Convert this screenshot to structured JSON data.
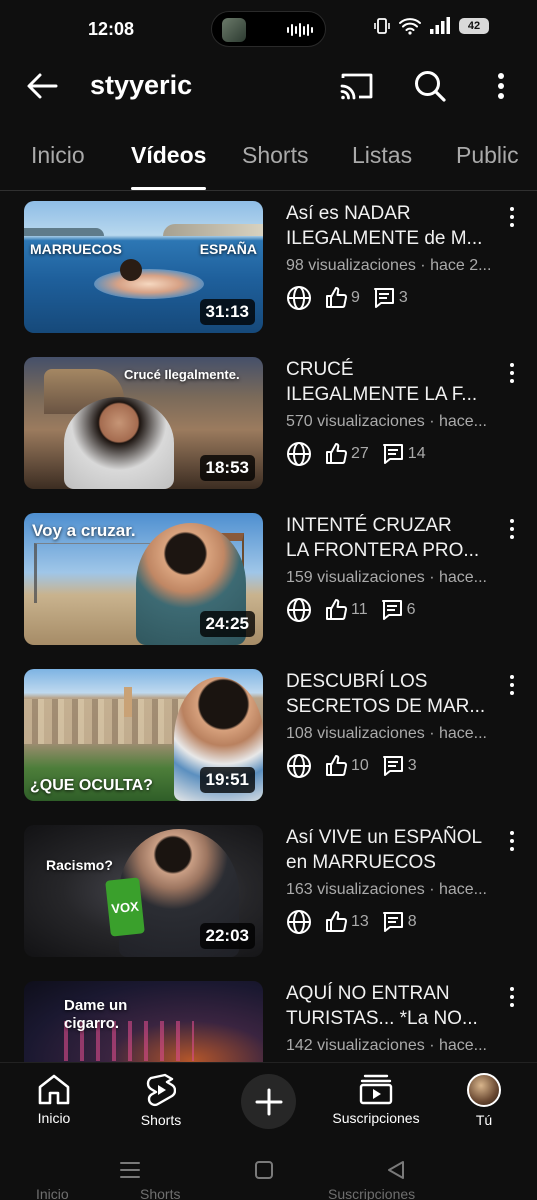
{
  "status": {
    "time": "12:08",
    "battery": "42"
  },
  "header": {
    "title": "styyeric"
  },
  "tabs": [
    "Inicio",
    "Vídeos",
    "Shorts",
    "Listas",
    "Public"
  ],
  "videos": [
    {
      "title_line1": "Así es NADAR",
      "title_line2": "ILEGALMENTE de M...",
      "meta": "98 visualizaciones · hace 2...",
      "likes": "9",
      "comments": "3",
      "duration": "31:13",
      "thumb_text": [
        "MARRUECOS",
        "ESPAÑA"
      ]
    },
    {
      "title_line1": "CRUCÉ",
      "title_line2": "ILEGALMENTE LA F...",
      "meta": "570 visualizaciones · hace...",
      "likes": "27",
      "comments": "14",
      "duration": "18:53",
      "thumb_text": [
        "Crucé Ilegalmente."
      ]
    },
    {
      "title_line1": "INTENTÉ CRUZAR",
      "title_line2": "LA FRONTERA PRO...",
      "meta": "159 visualizaciones · hace...",
      "likes": "11",
      "comments": "6",
      "duration": "24:25",
      "thumb_text": [
        "Voy a cruzar."
      ]
    },
    {
      "title_line1": "DESCUBRÍ LOS",
      "title_line2": "SECRETOS DE MAR...",
      "meta": "108 visualizaciones · hace...",
      "likes": "10",
      "comments": "3",
      "duration": "19:51",
      "thumb_text": [
        "¿QUE OCULTA?"
      ]
    },
    {
      "title_line1": "Así VIVE un ESPAÑOL",
      "title_line2": "en MARRUECOS",
      "meta": "163 visualizaciones · hace...",
      "likes": "13",
      "comments": "8",
      "duration": "22:03",
      "thumb_text": [
        "Racismo?",
        "VOX"
      ]
    },
    {
      "title_line1": "AQUÍ NO ENTRAN",
      "title_line2": "TURISTAS... *La NO...",
      "meta": "142 visualizaciones · hace...",
      "likes": "",
      "comments": "",
      "duration": "",
      "thumb_text": [
        "Dame un",
        "cigarro."
      ]
    }
  ],
  "bottom_nav": {
    "home": "Inicio",
    "shorts": "Shorts",
    "subscriptions": "Suscripciones",
    "you": "Tú"
  },
  "ghost_labels": [
    "Inicio",
    "Shorts",
    "Suscripciones"
  ]
}
